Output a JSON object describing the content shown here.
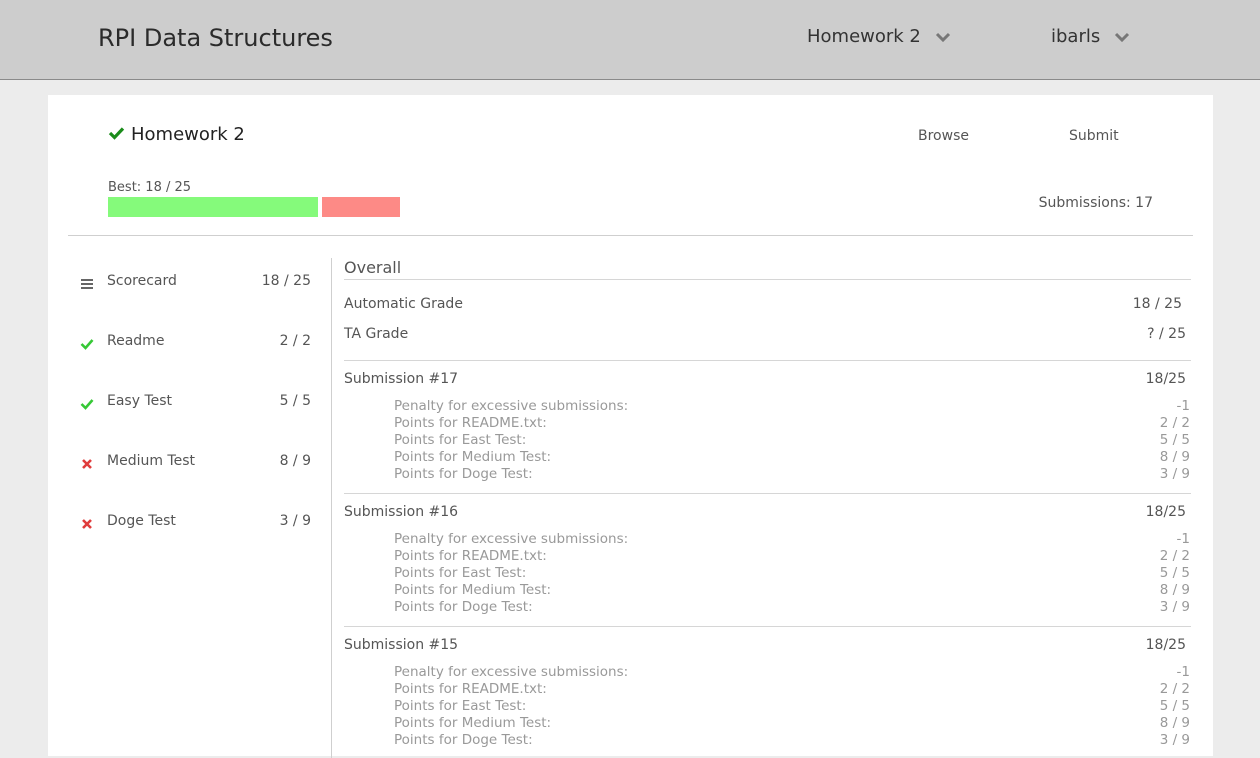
{
  "header": {
    "app_title": "RPI Data Structures",
    "assignment_menu": "Homework 2",
    "user_menu": "ibarls"
  },
  "assignment": {
    "title": "Homework 2",
    "browse_label": "Browse",
    "submit_label": "Submit",
    "best_label": "Best: 18 / 25",
    "best_score": 18,
    "max_score": 25,
    "submissions_label": "Submissions: 17"
  },
  "colors": {
    "accent_green": "#1b8c1b",
    "pass_green": "#37c837",
    "fail_red": "#e03c3c",
    "bar_green": "#85fa7b",
    "bar_red": "#fd8a86"
  },
  "sidebar": {
    "items": [
      {
        "icon": "list-icon",
        "label": "Scorecard",
        "score": "18 / 25"
      },
      {
        "icon": "check-icon",
        "label": "Readme",
        "score": "2 / 2"
      },
      {
        "icon": "check-icon",
        "label": "Easy Test",
        "score": "5 / 5"
      },
      {
        "icon": "x-icon",
        "label": "Medium Test",
        "score": "8 / 9"
      },
      {
        "icon": "x-icon",
        "label": "Doge Test",
        "score": "3 / 9"
      }
    ]
  },
  "overall": {
    "title": "Overall",
    "automatic_label": "Automatic Grade",
    "automatic_score": "18 / 25",
    "ta_label": "TA Grade",
    "ta_score": "? / 25"
  },
  "submissions": [
    {
      "title": "Submission #17",
      "score": "18/25",
      "details": [
        {
          "label": "Penalty for excessive submissions:",
          "value": "-1"
        },
        {
          "label": "Points for README.txt:",
          "value": "2 / 2"
        },
        {
          "label": "Points for East Test:",
          "value": "5 / 5"
        },
        {
          "label": "Points for Medium Test:",
          "value": "8 / 9"
        },
        {
          "label": "Points for Doge Test:",
          "value": "3 / 9"
        }
      ]
    },
    {
      "title": "Submission #16",
      "score": "18/25",
      "details": [
        {
          "label": "Penalty for excessive submissions:",
          "value": "-1"
        },
        {
          "label": "Points for README.txt:",
          "value": "2 / 2"
        },
        {
          "label": "Points for East Test:",
          "value": "5 / 5"
        },
        {
          "label": "Points for Medium Test:",
          "value": "8 / 9"
        },
        {
          "label": "Points for Doge Test:",
          "value": "3 / 9"
        }
      ]
    },
    {
      "title": "Submission #15",
      "score": "18/25",
      "details": [
        {
          "label": "Penalty for excessive submissions:",
          "value": "-1"
        },
        {
          "label": "Points for README.txt:",
          "value": "2 / 2"
        },
        {
          "label": "Points for East Test:",
          "value": "5 / 5"
        },
        {
          "label": "Points for Medium Test:",
          "value": "8 / 9"
        },
        {
          "label": "Points for Doge Test:",
          "value": "3 / 9"
        }
      ]
    }
  ]
}
